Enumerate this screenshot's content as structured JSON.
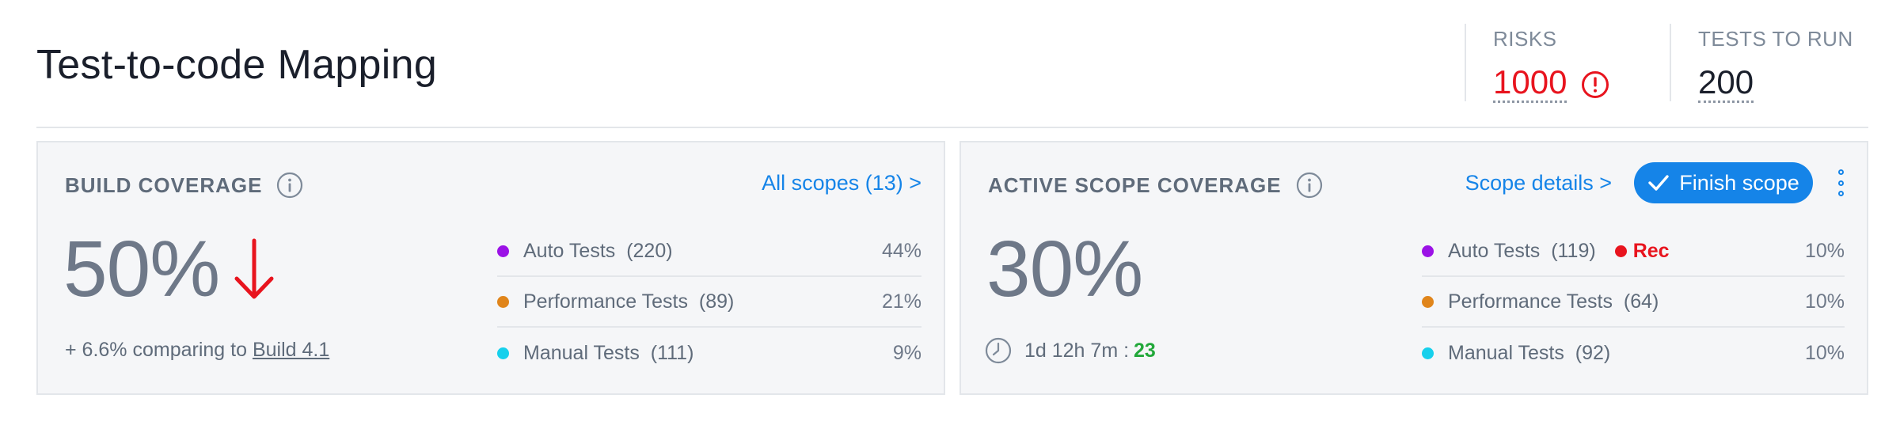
{
  "page": {
    "title": "Test-to-code Mapping"
  },
  "kpis": {
    "risks": {
      "label": "RISKS",
      "value": "1000"
    },
    "tests_to_run": {
      "label": "TESTS TO RUN",
      "value": "200"
    }
  },
  "colors": {
    "accent": "#1584e8",
    "danger": "#e8141e",
    "success": "#22a83a",
    "auto_tests": "#9b12e6",
    "performance_tests": "#e0851b",
    "manual_tests": "#16d0ec"
  },
  "build_coverage": {
    "title": "BUILD COVERAGE",
    "link": "All scopes (13) >",
    "percentage": "50%",
    "trend_icon": "arrow-down-icon",
    "comparison_prefix": "+ 6.6% comparing to ",
    "comparison_build": "Build 4.1",
    "rows": [
      {
        "name": "Auto Tests",
        "count": "(220)",
        "pct": "44%",
        "color": "#9b12e6"
      },
      {
        "name": "Performance Tests",
        "count": "(89)",
        "pct": "21%",
        "color": "#e0851b"
      },
      {
        "name": "Manual Tests",
        "count": "(111)",
        "pct": "9%",
        "color": "#16d0ec"
      }
    ]
  },
  "active_scope_coverage": {
    "title": "ACTIVE SCOPE COVERAGE",
    "link": "Scope details >",
    "button": "Finish scope",
    "percentage": "30%",
    "timer": "1d 12h 7m :",
    "timer_count": "23",
    "rec_label": "Rec",
    "rows": [
      {
        "name": "Auto Tests",
        "count": "(119)",
        "pct": "10%",
        "color": "#9b12e6"
      },
      {
        "name": "Performance Tests",
        "count": "(64)",
        "pct": "10%",
        "color": "#e0851b"
      },
      {
        "name": "Manual Tests",
        "count": "(92)",
        "pct": "10%",
        "color": "#16d0ec"
      }
    ]
  }
}
